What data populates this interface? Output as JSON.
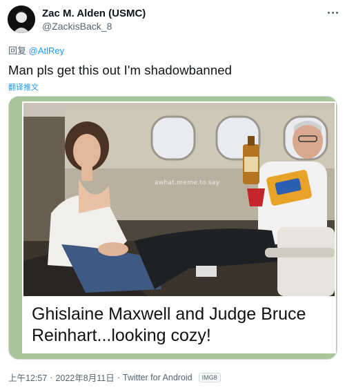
{
  "user": {
    "display_name": "Zac M. Alden (USMC)",
    "handle": "@ZackisBack_8"
  },
  "reply": {
    "prefix": "回复",
    "mention": "@AtlRey"
  },
  "tweet": {
    "text": "Man pls get this out I'm shadowbanned",
    "translate_label": "翻译推文"
  },
  "media": {
    "watermark": "awhat.meme.to.say",
    "caption": "Ghislaine Maxwell and Judge Bruce Reinhart...looking cozy!"
  },
  "meta": {
    "time": "上午12:57",
    "date": "2022年8月11日",
    "source": "Twitter for Android",
    "badge": "IMG8"
  },
  "colors": {
    "accent": "#1d9bf0",
    "secondary_text": "#536471",
    "card_border": "#a9c69a"
  },
  "icons": {
    "more": "more-horizontal-icon",
    "avatar": "avatar-image"
  }
}
